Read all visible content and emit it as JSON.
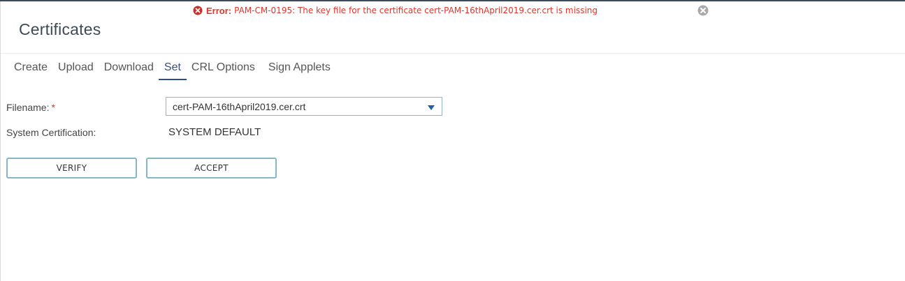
{
  "notification": {
    "severity_label": "Error:",
    "message": "PAM-CM-0195: The key file for the certificate cert-PAM-16thApril2019.cer.crt is missing",
    "error_color": "#e0352b"
  },
  "page": {
    "title": "Certificates"
  },
  "tabs": [
    {
      "label": "Create",
      "active": false
    },
    {
      "label": "Upload",
      "active": false
    },
    {
      "label": "Download",
      "active": false
    },
    {
      "label": "Set",
      "active": true
    },
    {
      "label": "CRL Options",
      "active": false
    },
    {
      "label": "Sign Applets",
      "active": false
    }
  ],
  "form": {
    "filename_label": "Filename:",
    "required_marker": "*",
    "filename_value": "cert-PAM-16thApril2019.cer.crt",
    "system_cert_label": "System Certification:",
    "system_cert_value": "SYSTEM DEFAULT"
  },
  "actions": {
    "verify_label": "VERIFY",
    "accept_label": "ACCEPT"
  },
  "icons": {
    "error": "error-circle-x-icon",
    "dismiss": "close-circle-icon",
    "dropdown": "caret-down-icon"
  },
  "colors": {
    "accent": "#2d4c8a",
    "button_border": "#84b6c5",
    "select_border": "#8fb2d6"
  }
}
